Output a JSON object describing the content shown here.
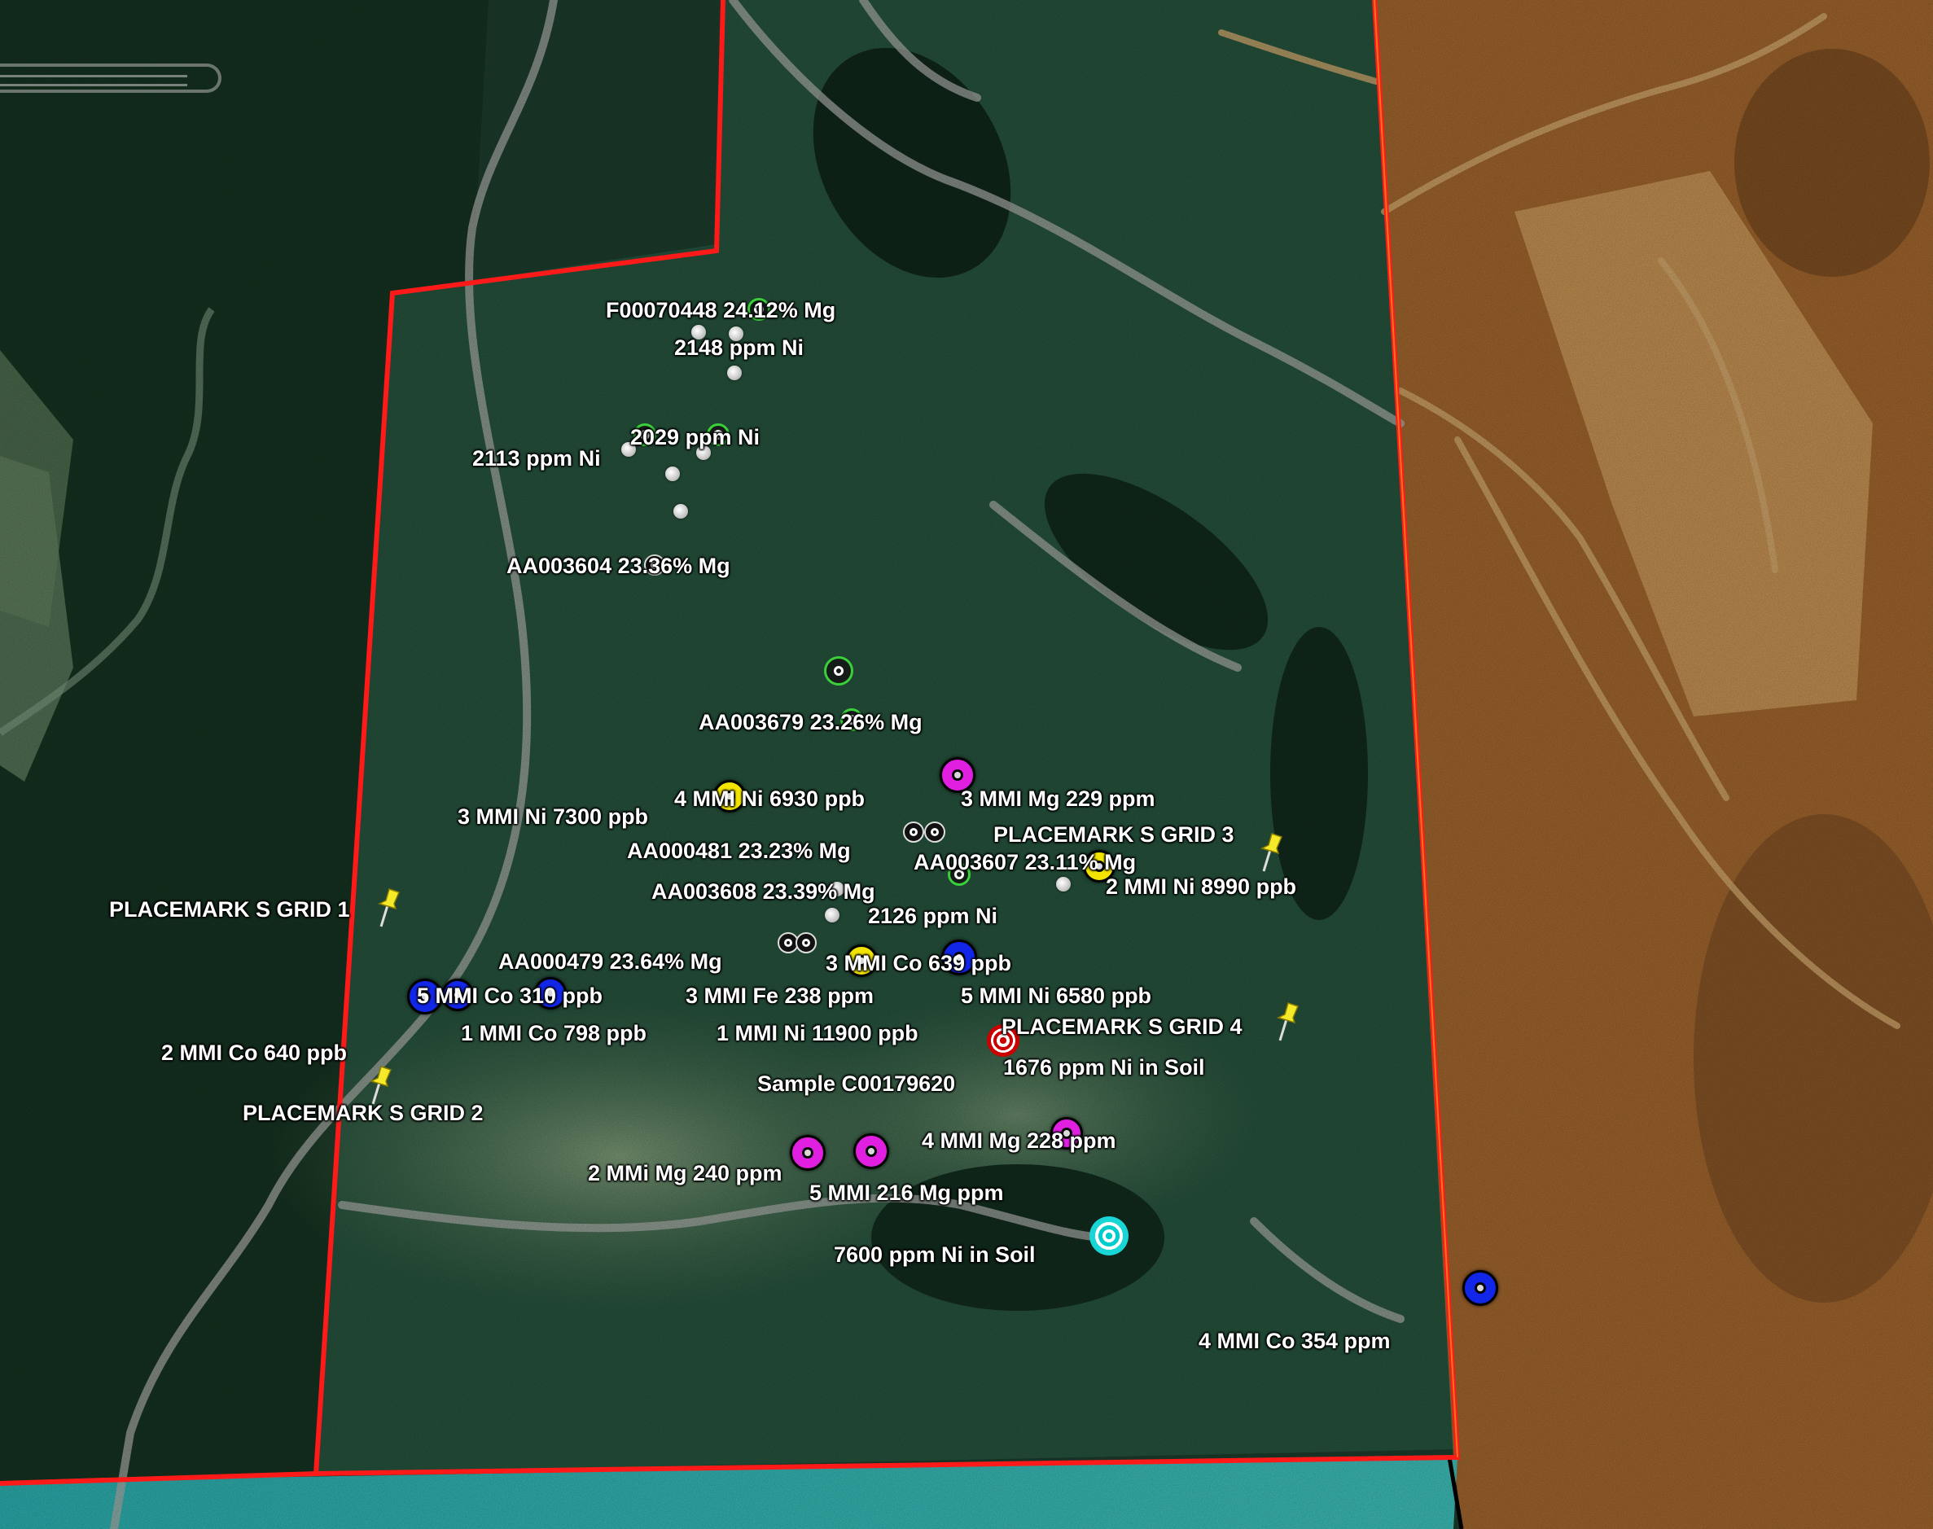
{
  "map": {
    "colors": {
      "boundary": "#ff1a1a",
      "adjacent_claim_fill": "#a8682c",
      "water": "#2aa7a7",
      "forest": "#1f4a34",
      "road": "#9fa3a0"
    }
  },
  "samples": [
    {
      "id": "f00070448",
      "text": "F00070448   24.12% Mg",
      "marker": "ring"
    },
    {
      "id": "ni-2148",
      "text": "2148 ppm Ni",
      "marker": "dot"
    },
    {
      "id": "ni-2029",
      "text": "2029 ppm Ni",
      "marker": "ring"
    },
    {
      "id": "ni-2113",
      "text": "2113 ppm Ni",
      "marker": "dot"
    },
    {
      "id": "aa003604",
      "text": "AA003604   23.36% Mg",
      "marker": "wring"
    },
    {
      "id": "aa003679",
      "text": "AA003679   23.26% Mg",
      "marker": "ring"
    },
    {
      "id": "mmi4-ni",
      "text": "4 MMI Ni 6930 ppb",
      "marker": "yellow-target"
    },
    {
      "id": "mmi3-mg",
      "text": "3 MMI Mg 229 ppm",
      "marker": "magenta-target"
    },
    {
      "id": "mmi3-ni",
      "text": "3 MMI Ni 7300 ppb",
      "marker": "none"
    },
    {
      "id": "aa000481",
      "text": "AA000481   23.23% Mg",
      "marker": "wring"
    },
    {
      "id": "aa003607",
      "text": "AA003607    23.11% Mg",
      "marker": "wring"
    },
    {
      "id": "mmi2-ni",
      "text": "2 MMI Ni 8990 ppb",
      "marker": "yellow-target"
    },
    {
      "id": "aa003608",
      "text": "AA003608    23.39% Mg",
      "marker": "dot"
    },
    {
      "id": "ni-2126",
      "text": "2126 ppm Ni",
      "marker": "dot"
    },
    {
      "id": "aa000479",
      "text": "AA000479    23.64% Mg",
      "marker": "wring"
    },
    {
      "id": "mmi3-co",
      "text": "3 MMI Co 639 ppb",
      "marker": "blue-target"
    },
    {
      "id": "mmi5-co",
      "text": "5 MMI Co 310 ppb",
      "marker": "blue-target"
    },
    {
      "id": "mmi3-fe",
      "text": "3 MMI Fe 238 ppm",
      "marker": "yellow-target"
    },
    {
      "id": "mmi5-ni",
      "text": "5 MMI Ni 6580 ppb",
      "marker": "none"
    },
    {
      "id": "mmi1-co",
      "text": "1 MMI Co 798 ppb",
      "marker": "blue-target"
    },
    {
      "id": "mmi1-ni",
      "text": "1 MMI Ni 11900 ppb",
      "marker": "none"
    },
    {
      "id": "mmi2-co",
      "text": "2 MMI Co 640 ppb",
      "marker": "none"
    },
    {
      "id": "soil-1676",
      "text": "1676 ppm Ni in Soil",
      "marker": "red-bullseye"
    },
    {
      "id": "sample-c00179620",
      "text": "Sample C00179620",
      "marker": "none"
    },
    {
      "id": "mmi4-mg",
      "text": "4 MMI Mg 228 ppm",
      "marker": "magenta-target"
    },
    {
      "id": "mmi2-mg",
      "text": "2 MMi Mg 240 ppm",
      "marker": "magenta-target"
    },
    {
      "id": "mmi5-mg",
      "text": "5 MMI 216 Mg ppm",
      "marker": "magenta-target"
    },
    {
      "id": "soil-7600",
      "text": "7600 ppm Ni in Soil",
      "marker": "cyan-bullseye"
    },
    {
      "id": "mmi4-co",
      "text": "4 MMI Co 354 ppm",
      "marker": "blue-target"
    }
  ],
  "placemarks": [
    {
      "id": "grid-1",
      "text": "PLACEMARK S GRID 1",
      "marker": "yellow-pushpin"
    },
    {
      "id": "grid-2",
      "text": "PLACEMARK S GRID 2",
      "marker": "yellow-pushpin"
    },
    {
      "id": "grid-3",
      "text": "PLACEMARK S GRID 3",
      "marker": "yellow-pushpin"
    },
    {
      "id": "grid-4",
      "text": "PLACEMARK S GRID 4",
      "marker": "yellow-pushpin"
    }
  ],
  "marker_colors": {
    "yellow-target": "#f2e400",
    "magenta-target": "#e01fe0",
    "blue-target": "#1226e8",
    "ring-green": "#3ad03a",
    "pushpin": "#f4ea2a"
  }
}
